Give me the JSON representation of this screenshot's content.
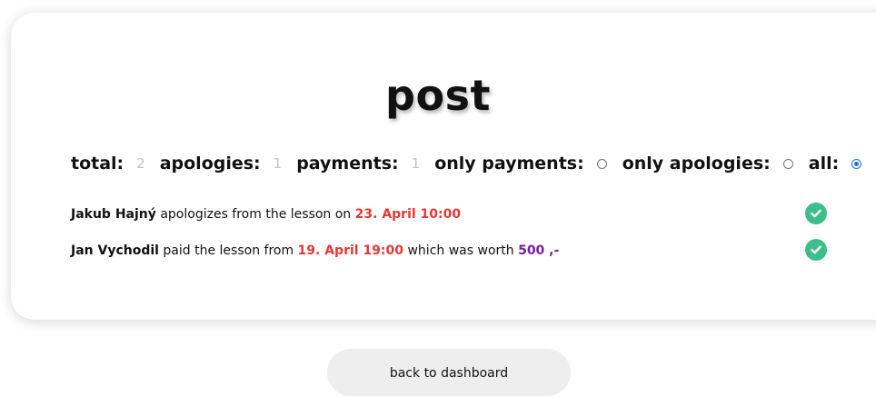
{
  "title": "post",
  "stats": {
    "total_label": "total:",
    "total_value": "2",
    "apologies_label": "apologies:",
    "apologies_value": "1",
    "payments_label": "payments:",
    "payments_value": "1"
  },
  "filters": [
    {
      "label": "only payments:",
      "selected": false
    },
    {
      "label": "only apologies:",
      "selected": false
    },
    {
      "label": "all:",
      "selected": true
    }
  ],
  "posts": [
    {
      "name": "Jakub Hajný",
      "text": " apologizes from the lesson on ",
      "date": "23. April 10:00",
      "icon": "check-circle-icon"
    },
    {
      "name": "Jan Vychodil",
      "text": " paid the lesson from ",
      "date": "19. April 19:00",
      "text2": " which was worth ",
      "amount": "500 ,-",
      "icon": "check-circle-icon"
    }
  ],
  "back_button": "back to dashboard",
  "colors": {
    "accent_red": "#e53935",
    "accent_purple": "#7b1fa2",
    "check_green": "#3dbf8c",
    "radio_blue": "#1a73e8"
  }
}
